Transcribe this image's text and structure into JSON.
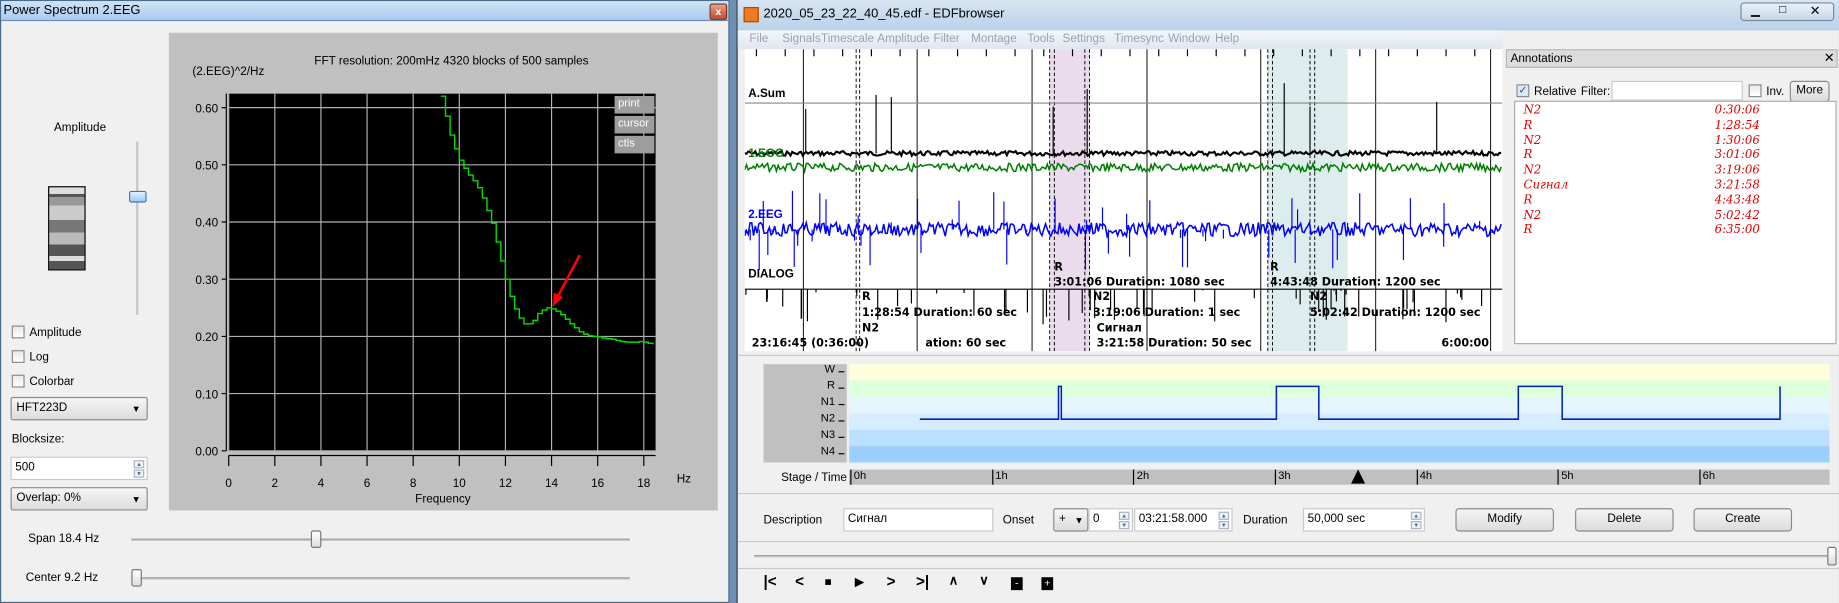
{
  "power_spectrum": {
    "window_title": "Power Spectrum 2.EEG",
    "amplitude_label": "Amplitude",
    "amplitude_slider_value": 0.7,
    "checkboxes": [
      {
        "label": "Amplitude",
        "checked": false
      },
      {
        "label": "Log",
        "checked": false
      },
      {
        "label": "Colorbar",
        "checked": false
      }
    ],
    "window_function": "HFT223D",
    "blocksize_label": "Blocksize:",
    "blocksize_value": "500",
    "overlap": "Overlap: 0%",
    "span_label": "Span 18.4 Hz",
    "span_value_fraction": 0.37,
    "center_label": "Center 9.2 Hz",
    "center_value_fraction": 0.0,
    "plot_buttons": [
      "print",
      "cursor",
      "ctls"
    ]
  },
  "chart_data": {
    "type": "line",
    "title": "FFT resolution: 200mHz   4320 blocks of 500 samples",
    "xlabel": "Frequency",
    "xunit": "Hz",
    "ylabel": "(2.EEG)^2/Hz",
    "xlim": [
      0,
      18.4
    ],
    "ylim": [
      0,
      0.62
    ],
    "xticks": [
      "0",
      "2",
      "4",
      "6",
      "8",
      "10",
      "12",
      "14",
      "16",
      "18"
    ],
    "yticks": [
      "0.00",
      "0.10",
      "0.20",
      "0.30",
      "0.40",
      "0.50",
      "0.60"
    ],
    "grid": true,
    "color": "#00e000",
    "x": [
      9.2,
      9.4,
      9.6,
      9.8,
      10.0,
      10.2,
      10.4,
      10.6,
      10.8,
      11.0,
      11.2,
      11.4,
      11.6,
      11.8,
      12.0,
      12.2,
      12.4,
      12.6,
      12.8,
      13.0,
      13.2,
      13.4,
      13.6,
      13.8,
      14.0,
      14.2,
      14.4,
      14.6,
      14.8,
      15.0,
      15.2,
      15.4,
      15.6,
      15.8,
      16.0,
      16.2,
      16.4,
      16.6,
      16.8,
      17.0,
      17.2,
      17.4,
      17.6,
      17.8,
      18.0,
      18.2,
      18.4
    ],
    "values": [
      0.62,
      0.585,
      0.552,
      0.528,
      0.508,
      0.494,
      0.482,
      0.472,
      0.46,
      0.442,
      0.42,
      0.398,
      0.365,
      0.332,
      0.3,
      0.27,
      0.248,
      0.232,
      0.222,
      0.222,
      0.228,
      0.24,
      0.246,
      0.25,
      0.248,
      0.244,
      0.238,
      0.23,
      0.222,
      0.215,
      0.208,
      0.204,
      0.201,
      0.2,
      0.199,
      0.197,
      0.196,
      0.195,
      0.193,
      0.191,
      0.19,
      0.19,
      0.19,
      0.191,
      0.19,
      0.188,
      0.186
    ],
    "annotation": "red arrow pointing at peak near 14 Hz"
  },
  "edf": {
    "window_title": "2020_05_23_22_40_45.edf - EDFbrowser",
    "menu": [
      "File",
      "Signals",
      "Timescale",
      "Amplitude",
      "Filter",
      "Montage",
      "Tools",
      "Settings",
      "Timesync",
      "Window",
      "Help"
    ],
    "signals": [
      "A.Sum",
      "1.EOG",
      "2.EEG",
      "DIALOG"
    ],
    "signal_annotations": [
      "R",
      "1:28:54 Duration: 60 sec",
      "N2",
      "ation: 60 sec",
      "R",
      "3:01:06 Duration: 1080 sec",
      "N2",
      "3:19:06 Duration: 1 sec",
      "Сигнал",
      "3:21:58 Duration: 50 sec",
      "R",
      "4:43:48 Duration: 1200 sec",
      "N2",
      "5:02:42 Duration: 1200 sec"
    ],
    "start_time": "23:16:45 (0:36:00)",
    "end_time": "6:00:00",
    "annotations_panel": {
      "title": "Annotations",
      "relative_label": "Relative",
      "relative_checked": true,
      "filter_label": "Filter:",
      "filter_value": "",
      "inv_label": "Inv.",
      "more_label": "More",
      "items": [
        {
          "label": "N2",
          "time": "0:30:06"
        },
        {
          "label": "R",
          "time": "1:28:54"
        },
        {
          "label": "N2",
          "time": "1:30:06"
        },
        {
          "label": "R",
          "time": "3:01:06"
        },
        {
          "label": "N2",
          "time": "3:19:06"
        },
        {
          "label": "Сигнал",
          "time": "3:21:58"
        },
        {
          "label": "R",
          "time": "4:43:48"
        },
        {
          "label": "N2",
          "time": "5:02:42"
        },
        {
          "label": "R",
          "time": "6:35:00"
        }
      ]
    },
    "hypnogram": {
      "stages": [
        "W",
        "R",
        "N1",
        "N2",
        "N3",
        "N4"
      ],
      "axis_label": "Stage / Time",
      "time_ticks": [
        "0h",
        "1h",
        "2h",
        "3h",
        "4h",
        "5h",
        "6h"
      ],
      "cursor_hours": 3.6
    },
    "editor": {
      "description_label": "Description",
      "description_value": "Сигнал",
      "onset_label": "Onset",
      "onset_sign": "+",
      "onset_days": "0",
      "onset_time": "03:21:58.000",
      "duration_label": "Duration",
      "duration_value": "50,000 sec",
      "modify": "Modify",
      "delete": "Delete",
      "create": "Create"
    },
    "nav_buttons": [
      "first-icon",
      "prev-icon",
      "stop-icon",
      "play-icon",
      "next-icon",
      "last-icon",
      "up-icon",
      "down-icon",
      "minus-icon",
      "plus-icon"
    ]
  }
}
